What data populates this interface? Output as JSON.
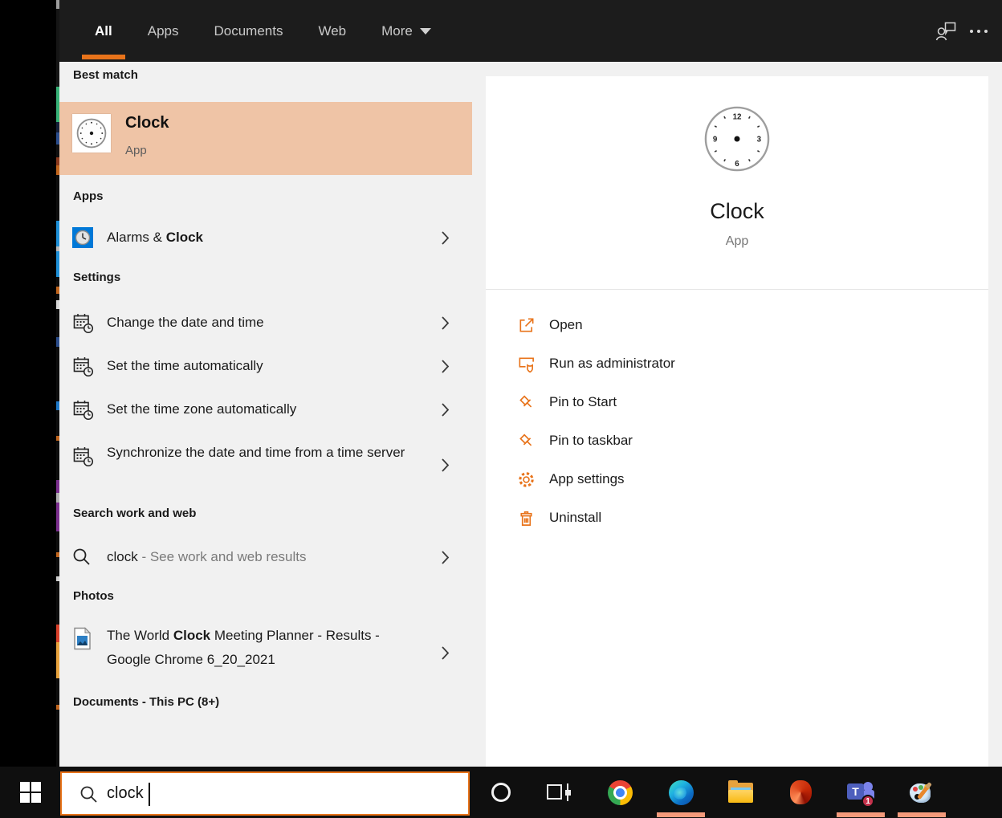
{
  "nav": {
    "tabs": [
      {
        "label": "All",
        "active": true
      },
      {
        "label": "Apps",
        "active": false
      },
      {
        "label": "Documents",
        "active": false
      },
      {
        "label": "Web",
        "active": false
      },
      {
        "label": "More",
        "active": false
      }
    ],
    "icons": [
      "feedback-user-icon",
      "ellipsis-icon"
    ]
  },
  "sections": {
    "best_match": {
      "header": "Best match",
      "item": {
        "title": "Clock",
        "subtitle": "App"
      }
    },
    "apps": {
      "header": "Apps",
      "item": {
        "pre": "Alarms & ",
        "bold": "Clock"
      }
    },
    "settings": {
      "header": "Settings",
      "items": [
        "Change the date and time",
        "Set the time automatically",
        "Set the time zone automatically",
        "Synchronize the date and time from a time server"
      ]
    },
    "search_web": {
      "header": "Search work and web",
      "item": {
        "query": "clock",
        "rest": " - See work and web results"
      }
    },
    "photos": {
      "header": "Photos",
      "item": {
        "pre": "The World ",
        "bold": "Clock",
        "post": " Meeting Planner - Results - Google Chrome 6_20_2021"
      }
    },
    "documents": {
      "header": "Documents - This PC (8+)"
    }
  },
  "preview": {
    "title": "Clock",
    "subtitle": "App",
    "clock_numbers": [
      "12",
      "3",
      "6",
      "9"
    ],
    "actions": [
      {
        "label": "Open",
        "icon": "open-icon"
      },
      {
        "label": "Run as administrator",
        "icon": "shield-icon"
      },
      {
        "label": "Pin to Start",
        "icon": "pin-icon"
      },
      {
        "label": "Pin to taskbar",
        "icon": "pin-icon"
      },
      {
        "label": "App settings",
        "icon": "gear-icon"
      },
      {
        "label": "Uninstall",
        "icon": "trash-icon"
      }
    ]
  },
  "taskbar": {
    "search_value": "clock",
    "teams_badge": "1",
    "icons": [
      "start",
      "cortana",
      "task-view",
      "chrome",
      "edge",
      "file-explorer",
      "office",
      "teams",
      "paint"
    ],
    "active_apps": [
      "edge",
      "teams",
      "paint"
    ]
  },
  "colors": {
    "accent_orange": "#e8731a",
    "best_match_highlight": "#efc4a6",
    "taskbar_underline": "#f49a7b",
    "nav_bg": "#1c1c1c",
    "panel_bg": "#f1f1f1"
  }
}
